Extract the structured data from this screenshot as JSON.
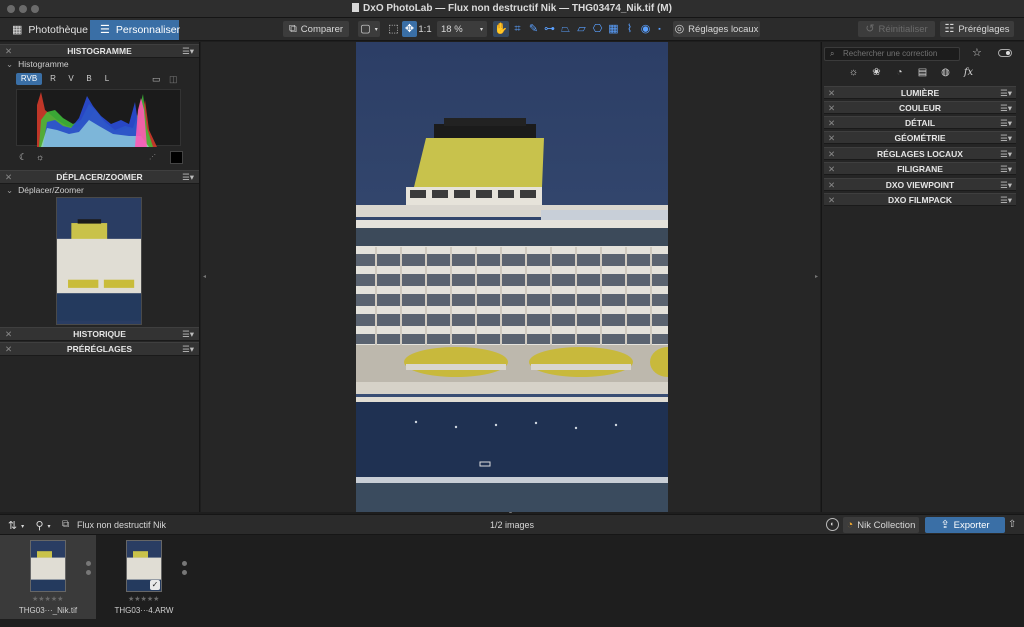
{
  "window": {
    "title": "DxO PhotoLab — Flux non destructif Nik — THG03474_Nik.tif (M)"
  },
  "toolbar": {
    "tabs": [
      {
        "label": "Photothèque"
      },
      {
        "label": "Personnaliser"
      }
    ],
    "compare_label": "Comparer",
    "ratio_label": "1:1",
    "zoom_value": "18 %",
    "local_adjust_label": "Réglages locaux",
    "reset_label": "Réinitialiser",
    "presets_label": "Préréglages"
  },
  "left_panel": {
    "histogram": {
      "header": "HISTOGRAMME",
      "sub": "Histogramme",
      "channels": [
        "RVB",
        "R",
        "V",
        "B",
        "L"
      ]
    },
    "navigator": {
      "header": "DÉPLACER/ZOOMER",
      "sub": "Déplacer/Zoomer"
    },
    "history_header": "HISTORIQUE",
    "presets_header": "PRÉRÉGLAGES"
  },
  "right_panel": {
    "search_placeholder": "Rechercher une correction",
    "palettes": [
      {
        "label": "LUMIÈRE"
      },
      {
        "label": "COULEUR"
      },
      {
        "label": "DÉTAIL"
      },
      {
        "label": "GÉOMÉTRIE"
      },
      {
        "label": "RÉGLAGES LOCAUX"
      },
      {
        "label": "FILIGRANE"
      },
      {
        "label": "DXO VIEWPOINT"
      },
      {
        "label": "DXO FILMPACK"
      }
    ]
  },
  "filmstrip": {
    "workflow_label": "Flux non destructif Nik",
    "count_label": "1/2 images",
    "nik_label": "Nik Collection",
    "export_label": "Exporter",
    "items": [
      {
        "name": "THG03···_Nik.tif",
        "stars": "★★★★★"
      },
      {
        "name": "THG03···4.ARW",
        "stars": "★★★★★"
      }
    ]
  }
}
